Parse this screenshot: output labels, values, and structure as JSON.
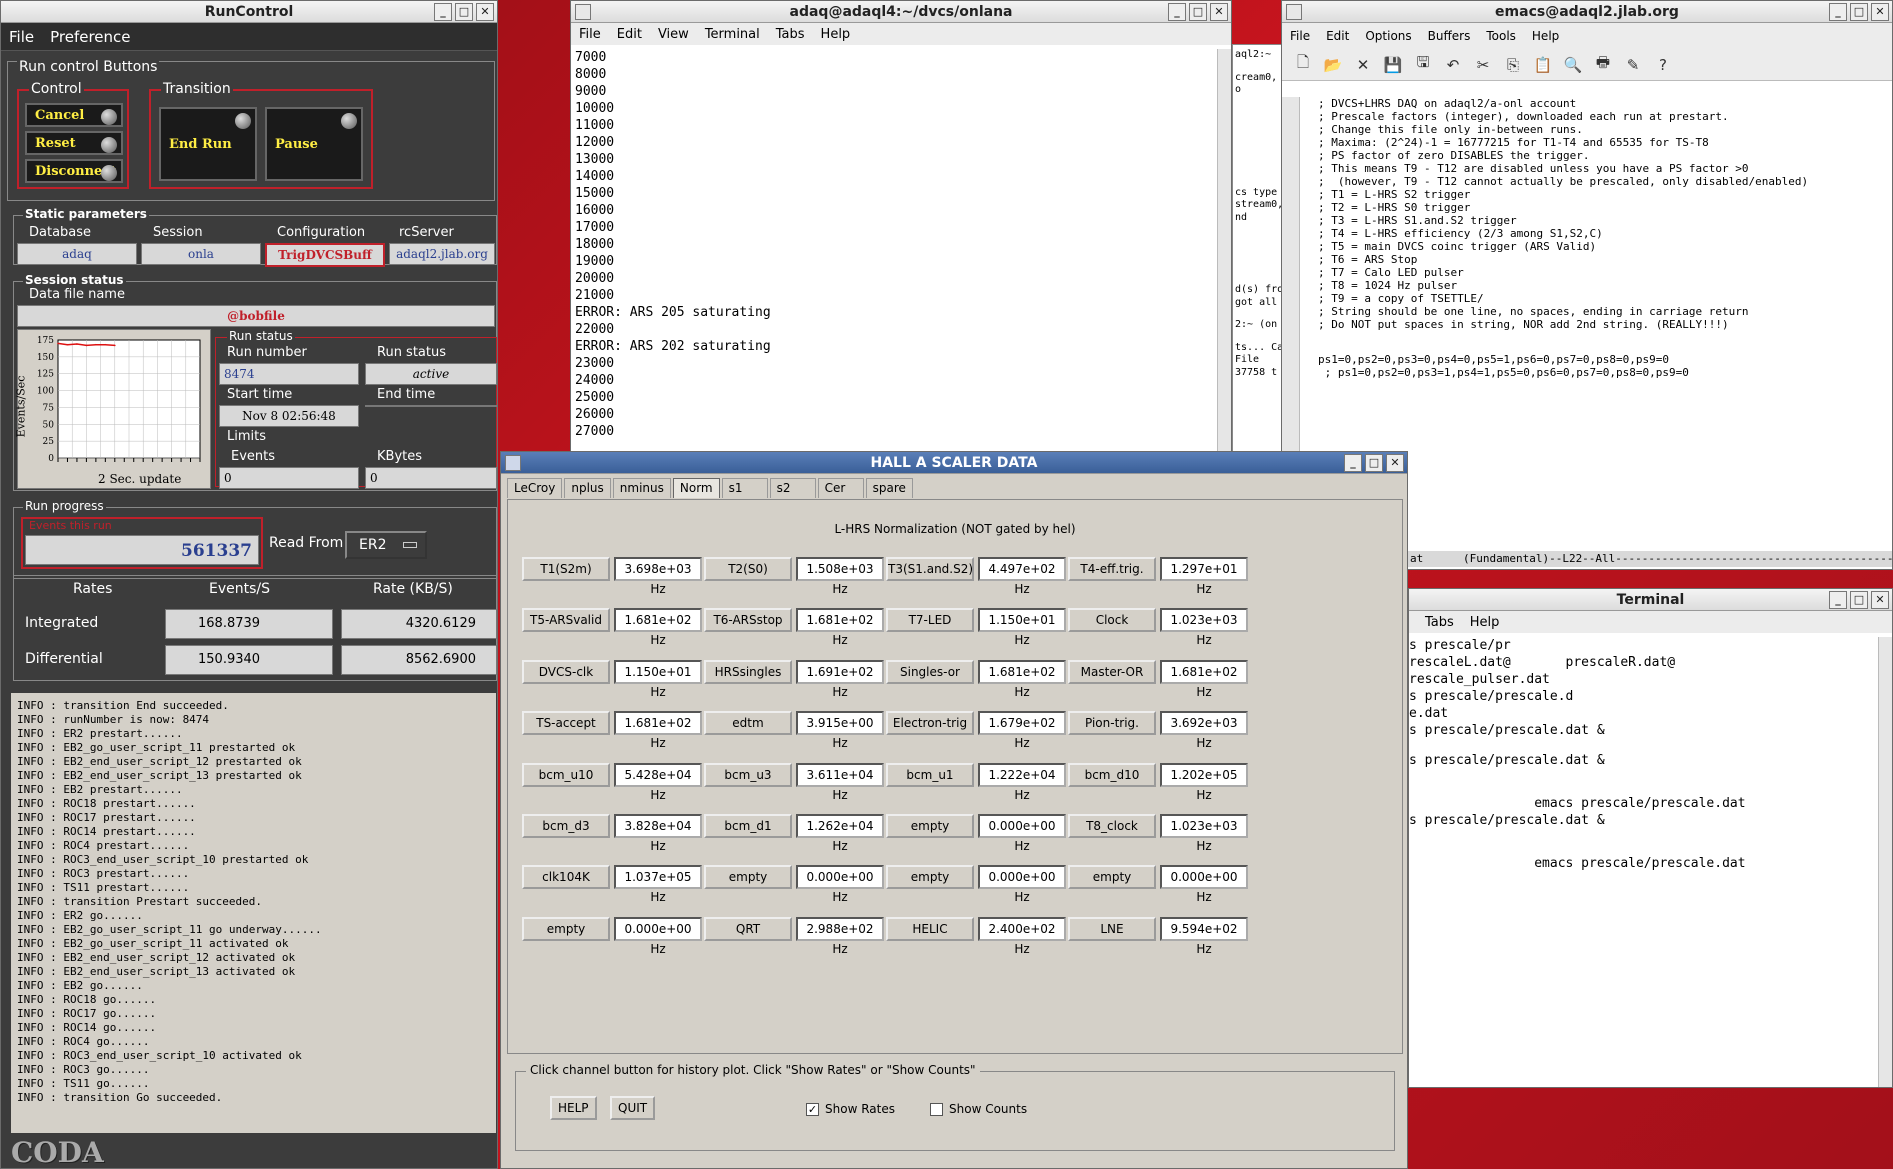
{
  "runcontrol": {
    "title": "RunControl",
    "menu": [
      "File",
      "Preference"
    ],
    "run_control_buttons_label": "Run control Buttons",
    "control_label": "Control",
    "transition_label": "Transition",
    "cancel": "Cancel",
    "reset": "Reset",
    "disconnect": "Disconnect",
    "end_run": "End Run",
    "pause": "Pause",
    "static_params_label": "Static parameters",
    "database_label": "Database",
    "database_value": "adaq",
    "session_label": "Session",
    "session_value": "onla",
    "config_label": "Configuration",
    "config_value": "TrigDVCSBuff",
    "rcserver_label": "rcServer",
    "rcserver_value": "adaql2.jlab.org",
    "session_status_label": "Session status",
    "data_file_label": "Data file name",
    "data_file_value": "@bobfile",
    "chart_ylabel": "Events/Sec",
    "chart_yticks": [
      "175",
      "150",
      "125",
      "100",
      "75",
      "50",
      "25",
      "0"
    ],
    "chart_update": "2 Sec. update",
    "run_status_group": "Run status",
    "run_number_label": "Run number",
    "run_number_value": "8474",
    "run_status_label": "Run status",
    "run_status_value": "active",
    "start_time_label": "Start time",
    "start_time_value": "Nov 8 02:56:48",
    "end_time_label": "End time",
    "limits_label": "Limits",
    "events_label": "Events",
    "events_value": "0",
    "kbytes_label": "KBytes",
    "kbytes_value": "0",
    "run_progress_label": "Run progress",
    "events_this_run_label": "Events this run",
    "events_this_run_value": "561337",
    "read_from_label": "Read From:",
    "read_from_value": "ER2",
    "rates_label": "Rates",
    "events_s_label": "Events/S",
    "rate_kbs_label": "Rate (KB/S)",
    "integrated_label": "Integrated",
    "integrated_events": "168.8739",
    "integrated_rate": "4320.6129",
    "differential_label": "Differential",
    "differential_events": "150.9340",
    "differential_rate": "8562.6900",
    "log_lines": [
      "INFO   : transition End succeeded.",
      "INFO   : runNumber is now: 8474",
      "INFO   : ER2 prestart......",
      "INFO   : EB2_go_user_script_11 prestarted ok",
      "INFO   : EB2_end_user_script_12 prestarted ok",
      "INFO   : EB2_end_user_script_13 prestarted ok",
      "INFO   : EB2 prestart......",
      "INFO   : ROC18 prestart......",
      "INFO   : ROC17 prestart......",
      "INFO   : ROC14 prestart......",
      "INFO   : ROC4 prestart......",
      "INFO   : ROC3_end_user_script_10 prestarted ok",
      "INFO   : ROC3 prestart......",
      "INFO   : TS11 prestart......",
      "INFO   : transition Prestart succeeded.",
      "INFO   : ER2 go......",
      "INFO   : EB2_go_user_script_11 go underway......",
      "INFO   : EB2_go_user_script_11 activated ok",
      "INFO   : EB2_end_user_script_12 activated ok",
      "INFO   : EB2_end_user_script_13 activated ok",
      "INFO   : EB2 go......",
      "INFO   : ROC18 go......",
      "INFO   : ROC17 go......",
      "INFO   : ROC14 go......",
      "INFO   : ROC4 go......",
      "INFO   : ROC3_end_user_script_10 activated ok",
      "INFO   : ROC3 go......",
      "INFO   : TS11 go......",
      "INFO   : transition Go succeeded."
    ],
    "logo": "CODA"
  },
  "term1": {
    "title": "adaq@adaql4:~/dvcs/onlana",
    "menu": [
      "File",
      "Edit",
      "View",
      "Terminal",
      "Tabs",
      "Help"
    ],
    "lines": [
      "7000",
      "8000",
      "9000",
      "10000",
      "11000",
      "12000",
      "13000",
      "14000",
      "15000",
      "16000",
      "17000",
      "18000",
      "19000",
      "20000",
      "21000",
      "ERROR: ARS 205 saturating",
      "22000",
      "ERROR: ARS 202 saturating",
      "23000",
      "24000",
      "25000",
      "26000",
      "27000"
    ]
  },
  "frag": {
    "lines": [
      "aql2:~",
      "",
      "cream0,",
      "o",
      "",
      "",
      "",
      "",
      "",
      "",
      "",
      "",
      "",
      "cs type",
      "stream0,",
      "nd",
      "",
      "",
      "",
      "",
      "",
      "",
      "d(s) fro",
      "got all",
      "",
      "2:~ (on",
      "",
      "ts... Ca",
      "File",
      "37758 t"
    ]
  },
  "emacs": {
    "title": "emacs@adaql2.jlab.org",
    "menu": [
      "File",
      "Edit",
      "Options",
      "Buffers",
      "Tools",
      "Help"
    ],
    "lines": [
      "; DVCS+LHRS DAQ on adaql2/a-onl account",
      "; Prescale factors (integer), downloaded each run at prestart.",
      "; Change this file only in-between runs.",
      "; Maxima: (2^24)-1 = 16777215 for T1-T4 and 65535 for TS-T8",
      "; PS factor of zero DISABLES the trigger.",
      "; This means T9 - T12 are disabled unless you have a PS factor >0",
      ";  (however, T9 - T12 cannot actually be prescaled, only disabled/enabled)",
      "; T1 = L-HRS S2 trigger",
      "; T2 = L-HRS S0 trigger",
      "; T3 = L-HRS S1.and.S2 trigger",
      "; T4 = L-HRS efficiency (2/3 among S1,S2,C)",
      "; T5 = main DVCS coinc trigger (ARS Valid)",
      "; T6 = ARS Stop",
      "; T7 = Calo LED pulser",
      "; T8 = 1024 Hz pulser",
      "; T9 = a copy of TSETTLE/",
      "; String should be one line, no spaces, ending in carriage return",
      "; Do NOT put spaces in string, NOR add 2nd string. (REALLY!!!)",
      "",
      "",
      "ps1=0,ps2=0,ps3=0,ps4=0,ps5=1,ps6=0,ps7=0,ps8=0,ps9=0",
      " ; ps1=0,ps2=0,ps3=1,ps4=1,ps5=0,ps6=0,ps7=0,ps8=0,ps9=0"
    ],
    "modeline": "at      (Fundamental)--L22--All-------------------------------------------"
  },
  "term2": {
    "title": "Terminal",
    "menu": [
      "Tabs",
      "Help"
    ],
    "lines": [
      "s prescale/pr",
      "rescaleL.dat@       prescaleR.dat@",
      "rescale_pulser.dat",
      "s prescale/prescale.d",
      "e.dat",
      "s prescale/prescale.dat &",
      "",
      "s prescale/prescale.dat &",
      "",
      "",
      "                emacs prescale/prescale.dat",
      "s prescale/prescale.dat &",
      "",
      "",
      "                emacs prescale/prescale.dat"
    ]
  },
  "scaler": {
    "title": "HALL  A  SCALER  DATA",
    "tabs": [
      "LeCroy",
      "nplus",
      "nminus",
      "Norm",
      "s1",
      "s2",
      "Cer",
      "spare"
    ],
    "active_tab": "Norm",
    "panel_title": "L-HRS Normalization (NOT gated by hel)",
    "rows": [
      [
        [
          "T1(S2m)",
          "3.698e+03 Hz"
        ],
        [
          "T2(S0)",
          "1.508e+03 Hz"
        ],
        [
          "T3(S1.and.S2)",
          "4.497e+02 Hz"
        ],
        [
          "T4-eff.trig.",
          "1.297e+01 Hz"
        ]
      ],
      [
        [
          "T5-ARSvalid",
          "1.681e+02 Hz"
        ],
        [
          "T6-ARSstop",
          "1.681e+02 Hz"
        ],
        [
          "T7-LED",
          "1.150e+01 Hz"
        ],
        [
          "Clock",
          "1.023e+03 Hz"
        ]
      ],
      [
        [
          "DVCS-clk",
          "1.150e+01 Hz"
        ],
        [
          "HRSsingles",
          "1.691e+02 Hz"
        ],
        [
          "Singles-or",
          "1.681e+02 Hz"
        ],
        [
          "Master-OR",
          "1.681e+02 Hz"
        ]
      ],
      [
        [
          "TS-accept",
          "1.681e+02 Hz"
        ],
        [
          "edtm",
          "3.915e+00 Hz"
        ],
        [
          "Electron-trig",
          "1.679e+02 Hz"
        ],
        [
          "Pion-trig.",
          "3.692e+03 Hz"
        ]
      ],
      [
        [
          "bcm_u10",
          "5.428e+04 Hz"
        ],
        [
          "bcm_u3",
          "3.611e+04 Hz"
        ],
        [
          "bcm_u1",
          "1.222e+04 Hz"
        ],
        [
          "bcm_d10",
          "1.202e+05 Hz"
        ]
      ],
      [
        [
          "bcm_d3",
          "3.828e+04 Hz"
        ],
        [
          "bcm_d1",
          "1.262e+04 Hz"
        ],
        [
          "empty",
          "0.000e+00 Hz"
        ],
        [
          "T8_clock",
          "1.023e+03 Hz"
        ]
      ],
      [
        [
          "clk104K",
          "1.037e+05 Hz"
        ],
        [
          "empty",
          "0.000e+00 Hz"
        ],
        [
          "empty",
          "0.000e+00 Hz"
        ],
        [
          "empty",
          "0.000e+00 Hz"
        ]
      ],
      [
        [
          "empty",
          "0.000e+00 Hz"
        ],
        [
          "QRT",
          "2.988e+02 Hz"
        ],
        [
          "HELIC",
          "2.400e+02 Hz"
        ],
        [
          "LNE",
          "9.594e+02 Hz"
        ]
      ]
    ],
    "hint": "Click channel button for history plot.  Click \"Show Rates\" or \"Show Counts\"",
    "help": "HELP",
    "quit": "QUIT",
    "show_rates": "Show Rates",
    "show_rates_checked": true,
    "show_counts": "Show Counts",
    "show_counts_checked": false
  },
  "chart_data": {
    "type": "line",
    "ylabel": "Events/Sec",
    "ylim": [
      0,
      175
    ],
    "x": [
      0,
      1,
      2,
      3,
      4,
      5,
      6
    ],
    "series": [
      {
        "values": [
          170,
          168,
          169,
          167,
          168,
          168,
          167
        ]
      }
    ],
    "grid": true
  },
  "colors": {
    "desktop": "#b5121b",
    "accent_red": "#c0202a",
    "button_text": "#ffee44"
  }
}
